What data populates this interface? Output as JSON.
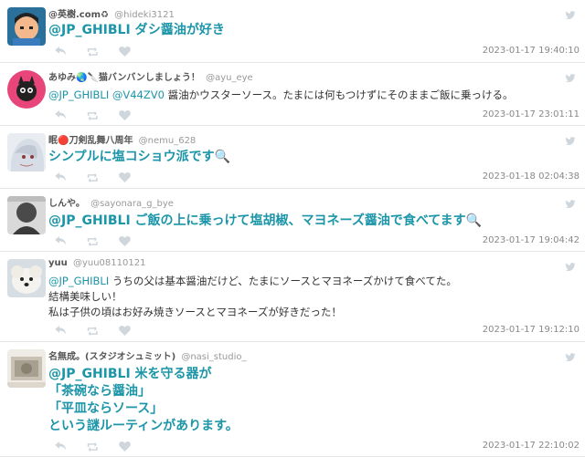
{
  "tweets": [
    {
      "name": "@英樹.com♻",
      "handle": "@hideki3121",
      "text_style": "big",
      "lines": [
        {
          "mention": "@JP_GHIBLI",
          "text": " ダシ醤油が好き"
        }
      ],
      "timestamp": "2023-01-17 19:40:10"
    },
    {
      "name": "あゆみ🌏🔪猫バンバンしましょう！",
      "handle": "@ayu_eye",
      "text_style": "small",
      "lines": [
        {
          "mention": "@JP_GHIBLI @V44ZV0",
          "text": " 醤油かウスターソース。たまには何もつけずにそのままご飯に乗っける。"
        }
      ],
      "timestamp": "2023-01-17 23:01:11"
    },
    {
      "name": "眠🔴刀剣乱舞八周年",
      "handle": "@nemu_628",
      "text_style": "big",
      "lines": [
        {
          "mention": "",
          "text": "シンプルに塩コショウ派です🔍"
        }
      ],
      "timestamp": "2023-01-18 02:04:38"
    },
    {
      "name": "しんや。",
      "handle": "@sayonara_g_bye",
      "text_style": "big",
      "lines": [
        {
          "mention": "@JP_GHIBLI",
          "text": " ご飯の上に乗っけて塩胡椒、マヨネーズ醤油で食べてます🔍"
        }
      ],
      "timestamp": "2023-01-17 19:04:42"
    },
    {
      "name": "yuu",
      "handle": "@yuu08110121",
      "text_style": "small",
      "lines": [
        {
          "mention": "@JP_GHIBLI",
          "text": " うちの父は基本醤油だけど、たまにソースとマヨネーズかけて食べてた。"
        },
        {
          "mention": "",
          "text": "結構美味しい！"
        },
        {
          "mention": "",
          "text": "私は子供の頃はお好み焼きソースとマヨネーズが好きだった！"
        }
      ],
      "timestamp": "2023-01-17 19:12:10"
    },
    {
      "name": "名無成。(スタジオシュミット)",
      "handle": "@nasi_studio_",
      "text_style": "big",
      "lines": [
        {
          "mention": "@JP_GHIBLI",
          "text": " 米を守る器が"
        },
        {
          "mention": "",
          "text": "「茶碗なら醤油」"
        },
        {
          "mention": "",
          "text": "「平皿ならソース」"
        },
        {
          "mention": "",
          "text": "という謎ルーティンがあります。"
        }
      ],
      "timestamp": "2023-01-17 22:10:02"
    }
  ],
  "icons": {
    "reply": "reply-icon",
    "retweet": "retweet-icon",
    "like": "heart-icon",
    "brand": "twitter-bird-icon"
  },
  "colors": {
    "accent": "#1b95a8",
    "icon": "#cfd6dc",
    "timestamp": "#888888"
  }
}
